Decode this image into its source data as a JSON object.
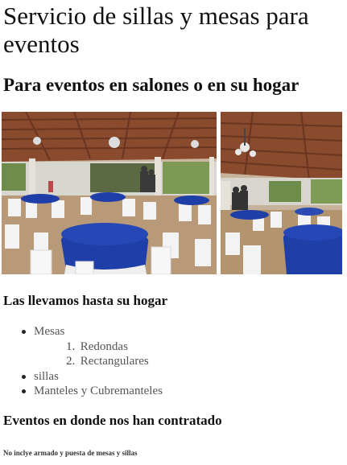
{
  "page": {
    "title": "Servicio de sillas y mesas para eventos",
    "subtitle": "Para eventos en salones o en su hogar"
  },
  "section_home": {
    "heading": "Las llevamos hasta su hogar",
    "items": [
      {
        "label": "Mesas",
        "subitems": [
          {
            "number": "1.",
            "label": "Redondas"
          },
          {
            "number": "2.",
            "label": "Rectangulares"
          }
        ]
      },
      {
        "label": "sillas"
      },
      {
        "label": "Manteles y Cubremanteles"
      }
    ]
  },
  "section_events": {
    "heading": "Eventos en donde nos han contratado",
    "note": "No inclye armado y puesta de mesas y sillas"
  },
  "colors": {
    "roof": "#8a4a2e",
    "tablecloth_blue": "#1f3fa8",
    "chair_white": "#f3f3f3"
  }
}
